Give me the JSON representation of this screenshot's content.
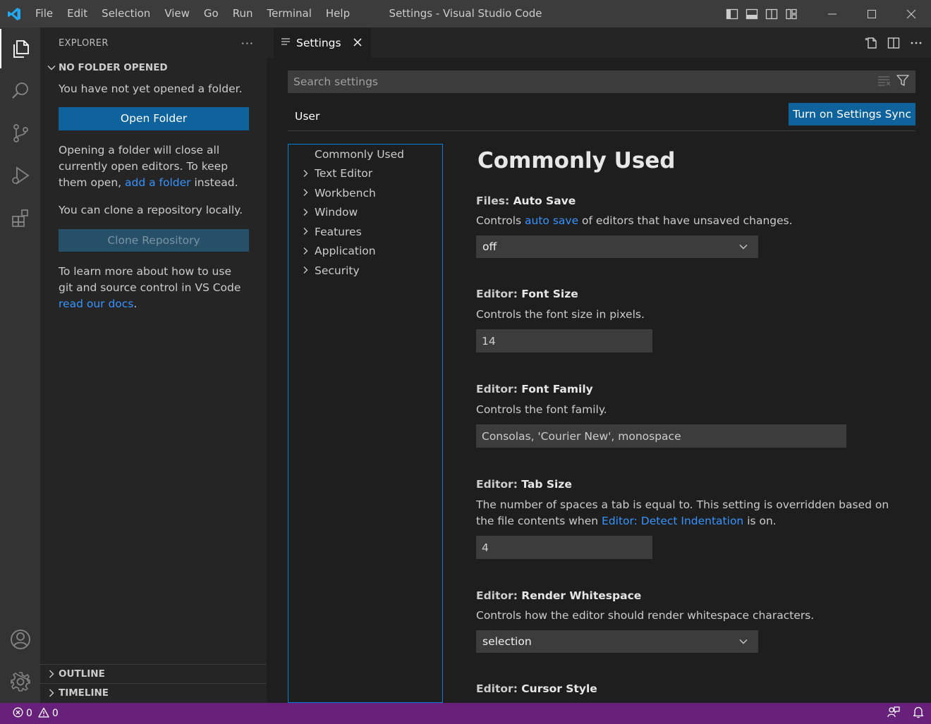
{
  "window": {
    "title": "Settings - Visual Studio Code",
    "app_icon": "vscode-logo-icon"
  },
  "menu": [
    "File",
    "Edit",
    "Selection",
    "View",
    "Go",
    "Run",
    "Terminal",
    "Help"
  ],
  "activity_bar": {
    "items": [
      "explorer-icon",
      "search-icon",
      "source-control-icon",
      "run-debug-icon",
      "extensions-icon"
    ],
    "bottom": [
      "accounts-icon",
      "manage-gear-icon"
    ]
  },
  "sidebar": {
    "title": "EXPLORER",
    "more": "···",
    "section": "NO FOLDER OPENED",
    "msg_no_folder": "You have not yet opened a folder.",
    "open_folder_button": "Open Folder",
    "msg_opening_1": "Opening a folder will close all currently open editors. To keep them open, ",
    "msg_opening_link": "add a folder",
    "msg_opening_2": " instead.",
    "msg_clone": "You can clone a repository locally.",
    "clone_button": "Clone Repository",
    "msg_learn_1": "To learn more about how to use git and source control in VS Code ",
    "msg_learn_link": "read our docs",
    "msg_learn_2": ".",
    "outline": "OUTLINE",
    "timeline": "TIMELINE"
  },
  "editor": {
    "tab_label": "Settings",
    "search_placeholder": "Search settings",
    "scope_tab": "User",
    "sync_button": "Turn on Settings Sync",
    "toc": [
      "Commonly Used",
      "Text Editor",
      "Workbench",
      "Window",
      "Features",
      "Application",
      "Security"
    ],
    "heading": "Commonly Used",
    "settings": {
      "auto_save": {
        "category": "Files: ",
        "name": "Auto Save",
        "desc_1": "Controls ",
        "desc_link": "auto save",
        "desc_2": " of editors that have unsaved changes.",
        "value": "off"
      },
      "font_size": {
        "category": "Editor: ",
        "name": "Font Size",
        "desc": "Controls the font size in pixels.",
        "value": "14"
      },
      "font_family": {
        "category": "Editor: ",
        "name": "Font Family",
        "desc": "Controls the font family.",
        "value": "Consolas, 'Courier New', monospace"
      },
      "tab_size": {
        "category": "Editor: ",
        "name": "Tab Size",
        "desc_1": "The number of spaces a tab is equal to. This setting is overridden based on the file contents when ",
        "desc_link": "Editor: Detect Indentation",
        "desc_2": " is on.",
        "value": "4"
      },
      "render_whitespace": {
        "category": "Editor: ",
        "name": "Render Whitespace",
        "desc": "Controls how the editor should render whitespace characters.",
        "value": "selection"
      },
      "cursor_style": {
        "category": "Editor: ",
        "name": "Cursor Style"
      }
    }
  },
  "status": {
    "errors": "0",
    "warnings": "0"
  },
  "colors": {
    "status_bar": "#68217a",
    "button": "#0e639c",
    "link": "#3794ff"
  }
}
